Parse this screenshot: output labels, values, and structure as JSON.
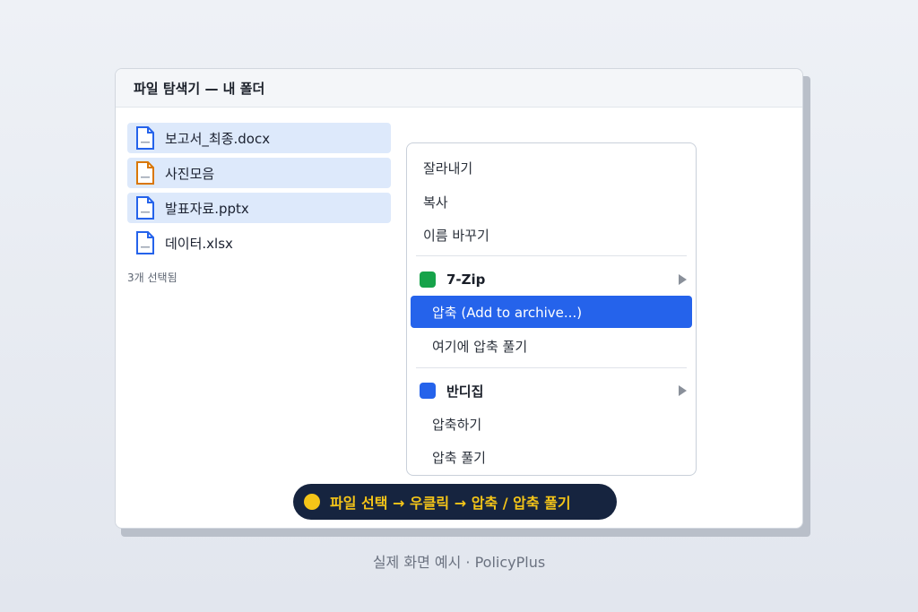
{
  "window": {
    "title": "파일 탐색기 — 내 폴더"
  },
  "files": [
    {
      "name": "보고서_최종.docx",
      "icon": "document-icon",
      "color": "#2563eb",
      "selected": true
    },
    {
      "name": "사진모음",
      "icon": "document-icon",
      "color": "#d97706",
      "selected": true
    },
    {
      "name": "발표자료.pptx",
      "icon": "document-icon",
      "color": "#2563eb",
      "selected": true
    },
    {
      "name": "데이터.xlsx",
      "icon": "document-icon",
      "color": "#2563eb",
      "selected": false
    }
  ],
  "selection_status": "3개 선택됨",
  "context_menu": {
    "cut": "잘라내기",
    "copy": "복사",
    "rename": "이름 바꾸기",
    "sevenzip": {
      "label": "7-Zip",
      "color": "#16a34a",
      "items": {
        "add_to_archive": "압축 (Add to archive...)",
        "extract_here": "여기에 압축 풀기"
      }
    },
    "bandizip": {
      "label": "반디집",
      "color": "#2563eb",
      "items": {
        "compress": "압축하기",
        "extract": "압축 풀기"
      }
    }
  },
  "hint": {
    "text": "파일 선택 → 우클릭 → 압축 / 압축 풀기",
    "color": "#f5c518"
  },
  "caption": "실제 화면 예시 · PolicyPlus",
  "colors": {
    "accent": "#2563eb",
    "selection_bg": "#dde9fb",
    "hint_bg": "#16243f"
  }
}
